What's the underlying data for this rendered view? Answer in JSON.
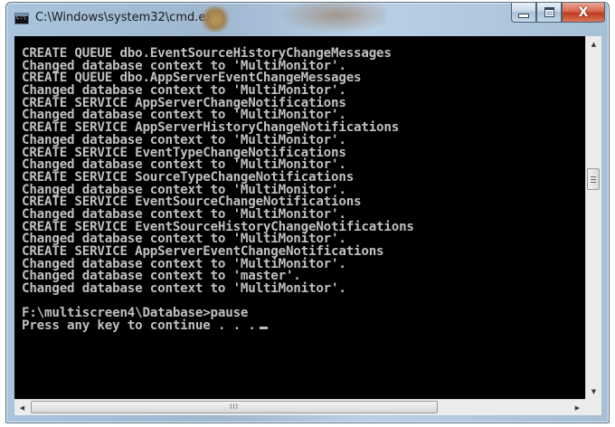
{
  "window": {
    "title": "C:\\Windows\\system32\\cmd.exe",
    "icon": "cmd-icon",
    "icon_text": "C:\\"
  },
  "caption_buttons": {
    "minimize_icon": "minimize-icon",
    "maximize_icon": "maximize-icon",
    "close_icon": "close-icon",
    "close_glyph": "X"
  },
  "console": {
    "lines": [
      "CREATE QUEUE dbo.EventSourceHistoryChangeMessages",
      "Changed database context to 'MultiMonitor'.",
      "CREATE QUEUE dbo.AppServerEventChangeMessages",
      "Changed database context to 'MultiMonitor'.",
      "CREATE SERVICE AppServerChangeNotifications",
      "Changed database context to 'MultiMonitor'.",
      "CREATE SERVICE AppServerHistoryChangeNotifications",
      "Changed database context to 'MultiMonitor'.",
      "CREATE SERVICE EventTypeChangeNotifications",
      "Changed database context to 'MultiMonitor'.",
      "CREATE SERVICE SourceTypeChangeNotifications",
      "Changed database context to 'MultiMonitor'.",
      "CREATE SERVICE EventSourceChangeNotifications",
      "Changed database context to 'MultiMonitor'.",
      "CREATE SERVICE EventSourceHistoryChangeNotifications",
      "Changed database context to 'MultiMonitor'.",
      "CREATE SERVICE AppServerEventChangeNotifications",
      "Changed database context to 'MultiMonitor'.",
      "Changed database context to 'master'.",
      "Changed database context to 'MultiMonitor'.",
      "",
      "F:\\multiscreen4\\Database>pause",
      "Press any key to continue . . ."
    ],
    "text_color": "#c0c0c0",
    "background_color": "#000000"
  },
  "scrollbars": {
    "up_arrow_icon": "scroll-up-arrow-icon",
    "down_arrow_icon": "scroll-down-arrow-icon",
    "left_arrow_icon": "scroll-left-arrow-icon",
    "right_arrow_icon": "scroll-right-arrow-icon",
    "up_glyph": "▲",
    "down_glyph": "▼",
    "left_glyph": "◀",
    "right_glyph": "▶",
    "h_grip": "III"
  }
}
